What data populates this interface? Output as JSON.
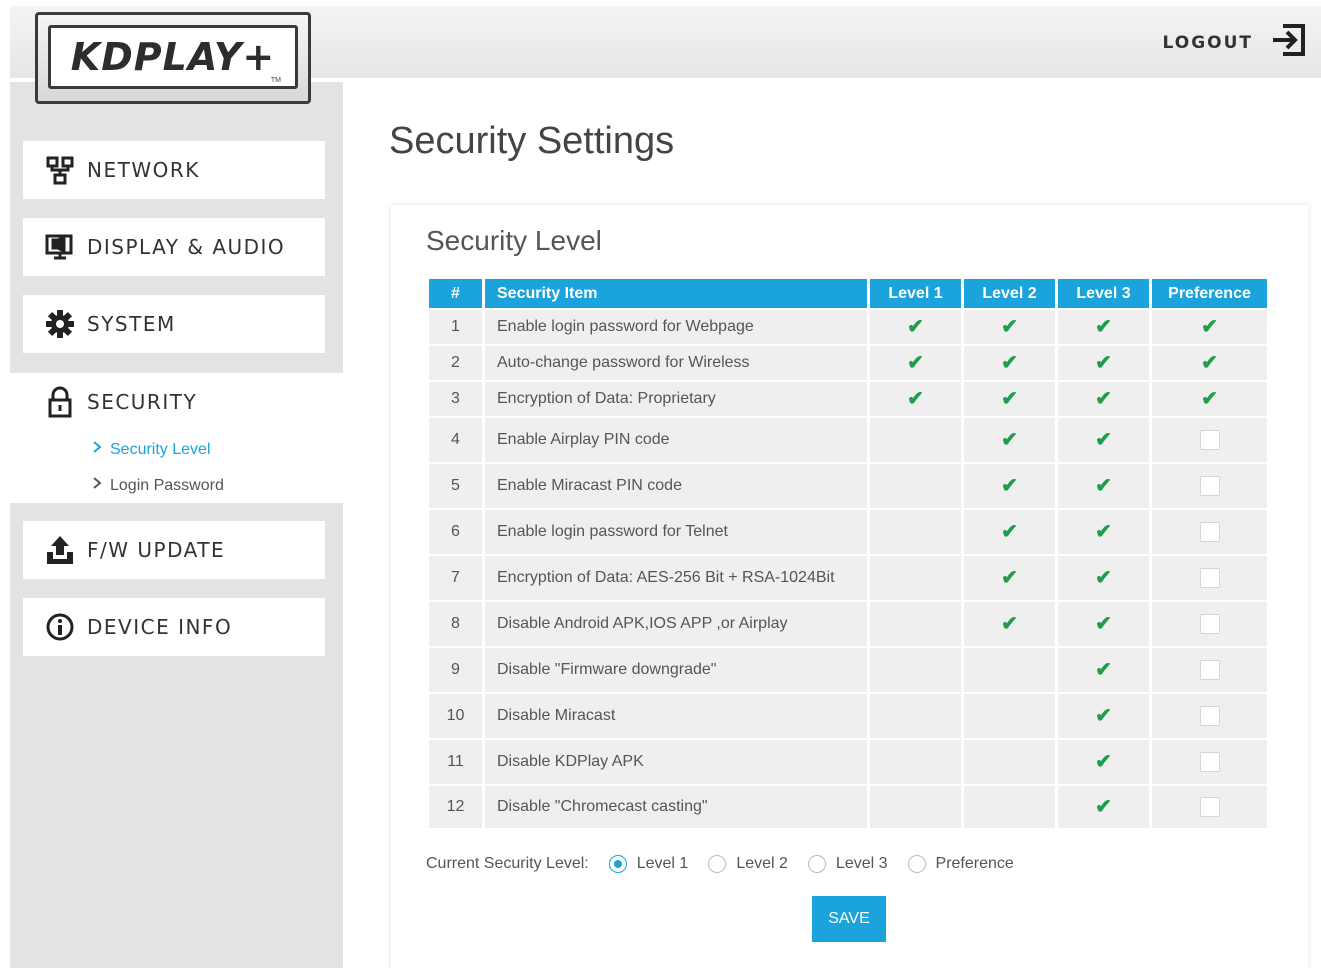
{
  "header": {
    "logout_label": "LOGOUT"
  },
  "logo": {
    "text": "KDPLAY+",
    "tm": "TM"
  },
  "sidebar": {
    "items": [
      {
        "label": "NETWORK"
      },
      {
        "label": "DISPLAY & AUDIO"
      },
      {
        "label": "SYSTEM"
      },
      {
        "label": "SECURITY"
      },
      {
        "label": "F/W UPDATE"
      },
      {
        "label": "DEVICE INFO"
      }
    ],
    "security_sub": [
      {
        "label": "Security Level"
      },
      {
        "label": "Login Password"
      }
    ]
  },
  "main": {
    "page_title": "Security Settings",
    "panel_title": "Security Level",
    "table": {
      "headers": [
        "#",
        "Security Item",
        "Level 1",
        "Level 2",
        "Level 3",
        "Preference"
      ],
      "rows": [
        {
          "num": "1",
          "item": "Enable login password for Webpage",
          "l1": true,
          "l2": true,
          "l3": true,
          "pref": "check"
        },
        {
          "num": "2",
          "item": "Auto-change password for Wireless",
          "l1": true,
          "l2": true,
          "l3": true,
          "pref": "check"
        },
        {
          "num": "3",
          "item": "Encryption of Data: Proprietary",
          "l1": true,
          "l2": true,
          "l3": true,
          "pref": "check"
        },
        {
          "num": "4",
          "item": "Enable Airplay PIN code",
          "l1": false,
          "l2": true,
          "l3": true,
          "pref": "box"
        },
        {
          "num": "5",
          "item": "Enable Miracast PIN code",
          "l1": false,
          "l2": true,
          "l3": true,
          "pref": "box"
        },
        {
          "num": "6",
          "item": "Enable login password for Telnet",
          "l1": false,
          "l2": true,
          "l3": true,
          "pref": "box"
        },
        {
          "num": "7",
          "item": "Encryption of Data: AES-256 Bit + RSA-1024Bit",
          "l1": false,
          "l2": true,
          "l3": true,
          "pref": "box"
        },
        {
          "num": "8",
          "item": "Disable Android APK,IOS APP ,or Airplay",
          "l1": false,
          "l2": true,
          "l3": true,
          "pref": "box"
        },
        {
          "num": "9",
          "item": "Disable \"Firmware downgrade\"",
          "l1": false,
          "l2": false,
          "l3": true,
          "pref": "box"
        },
        {
          "num": "10",
          "item": "Disable Miracast",
          "l1": false,
          "l2": false,
          "l3": true,
          "pref": "box"
        },
        {
          "num": "11",
          "item": "Disable KDPlay APK",
          "l1": false,
          "l2": false,
          "l3": true,
          "pref": "box"
        },
        {
          "num": "12",
          "item": "Disable \"Chromecast casting\"",
          "l1": false,
          "l2": false,
          "l3": true,
          "pref": "box"
        }
      ]
    },
    "current_level": {
      "label": "Current Security Level:",
      "options": [
        "Level 1",
        "Level 2",
        "Level 3",
        "Preference"
      ],
      "selected": "Level 1"
    },
    "save_label": "SAVE"
  },
  "colors": {
    "accent": "#1ba3db",
    "check": "#1e9e4a",
    "sidebar_bg": "#e3e3e3"
  }
}
